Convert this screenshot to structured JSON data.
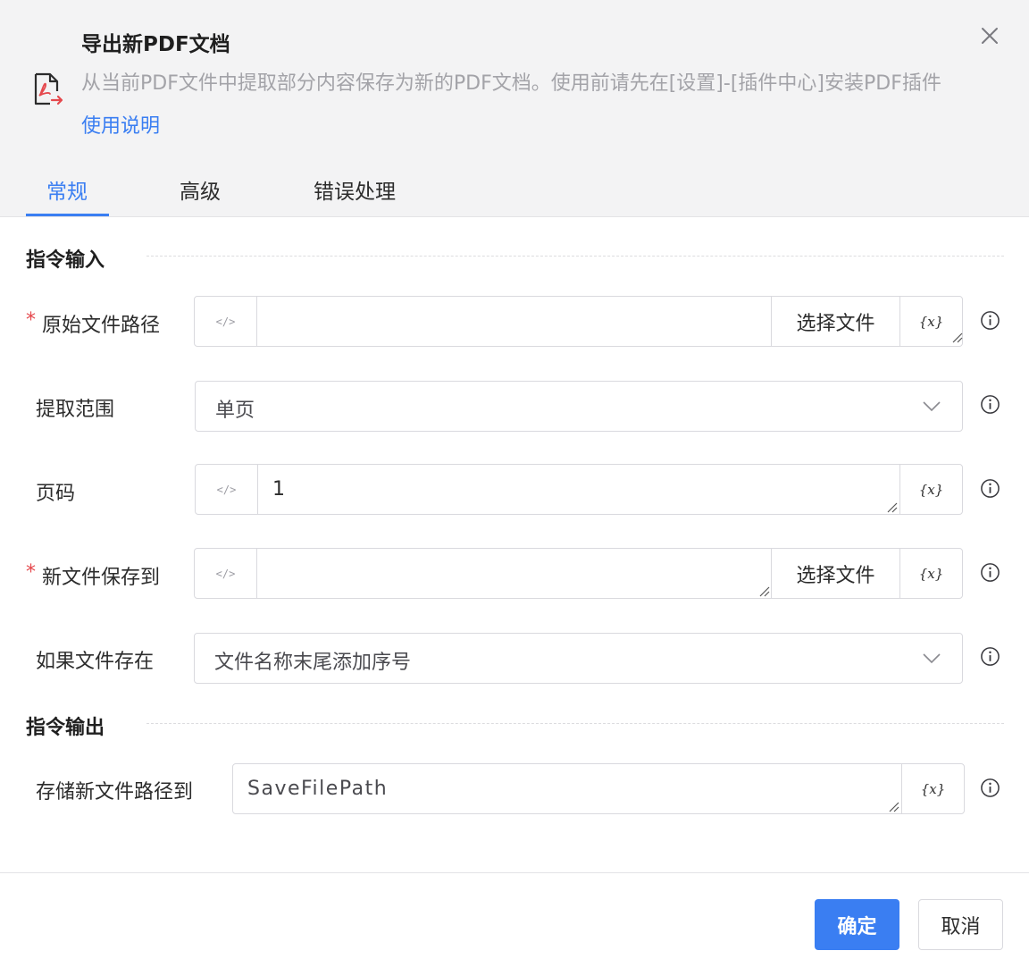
{
  "dialog": {
    "title": "导出新PDF文档",
    "description": "从当前PDF文件中提取部分内容保存为新的PDF文档。使用前请先在[设置]-[插件中心]安装PDF插件",
    "help_link": "使用说明",
    "icon": "pdf-export-icon",
    "close_icon": "close-icon"
  },
  "tabs": [
    {
      "label": "常规",
      "active": true
    },
    {
      "label": "高级",
      "active": false
    },
    {
      "label": "错误处理",
      "active": false
    }
  ],
  "sections": {
    "input_title": "指令输入",
    "output_title": "指令输出"
  },
  "fields": {
    "source_path": {
      "label": "原始文件路径",
      "required": "*",
      "value": "",
      "button": "选择文件",
      "var_label": "{x}",
      "code_label": "</>"
    },
    "extract_range": {
      "label": "提取范围",
      "value": "单页"
    },
    "page_number": {
      "label": "页码",
      "value": "1",
      "var_label": "{x}",
      "code_label": "</>"
    },
    "save_to": {
      "label": "新文件保存到",
      "required": "*",
      "value": "",
      "button": "选择文件",
      "var_label": "{x}",
      "code_label": "</>"
    },
    "if_exists": {
      "label": "如果文件存在",
      "value": "文件名称末尾添加序号"
    },
    "output_var": {
      "label": "存储新文件路径到",
      "value": "SaveFilePath",
      "var_label": "{x}"
    }
  },
  "footer": {
    "confirm": "确定",
    "cancel": "取消"
  },
  "colors": {
    "accent": "#3a7ef2",
    "required": "#e5484d",
    "header_bg": "#f3f3f4"
  }
}
